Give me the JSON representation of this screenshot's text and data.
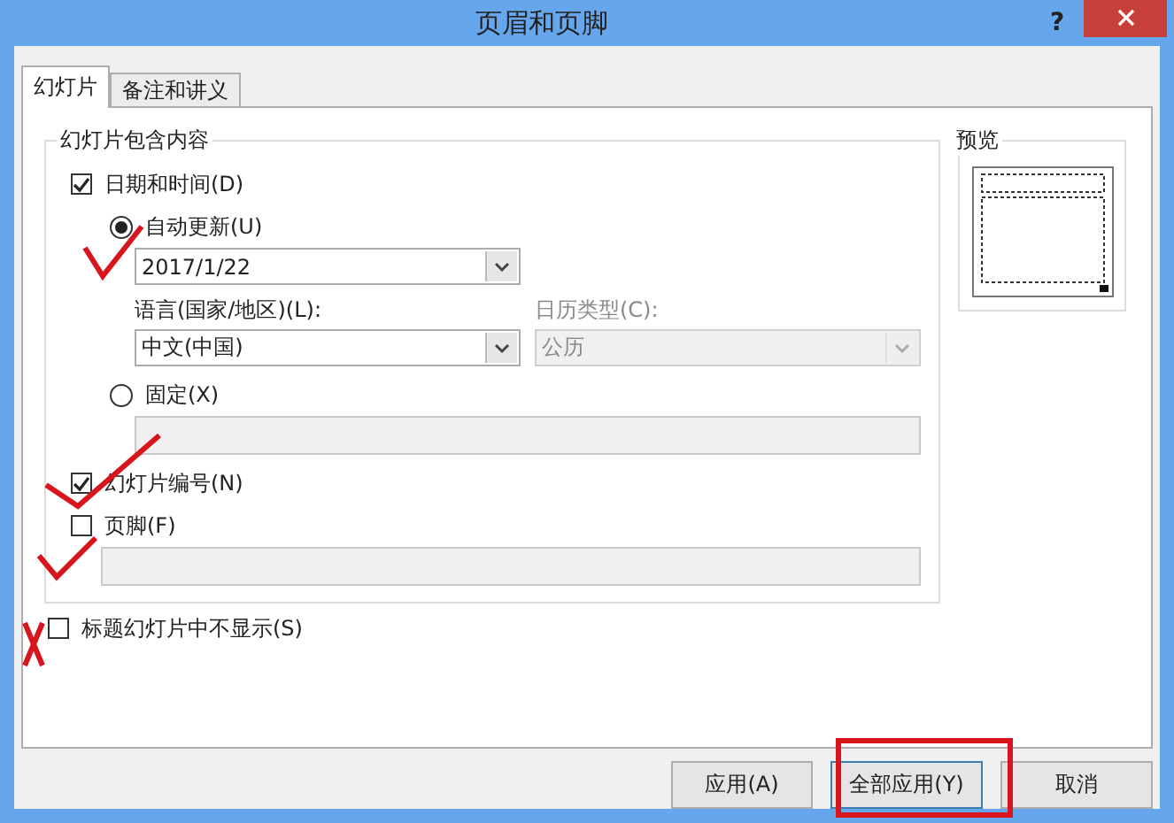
{
  "window": {
    "title": "页眉和页脚",
    "help": "?"
  },
  "tabs": [
    {
      "label": "幻灯片",
      "selected": true
    },
    {
      "label": "备注和讲义",
      "selected": false
    }
  ],
  "include_group": {
    "title": "幻灯片包含内容",
    "date_time": {
      "label": "日期和时间(D)",
      "checked": true
    },
    "auto_update": {
      "label": "自动更新(U)",
      "selected": true
    },
    "date_select": {
      "value": "2017/1/22"
    },
    "language": {
      "label": "语言(国家/地区)(L):",
      "value": "中文(中国)",
      "disabled": false
    },
    "calendar": {
      "label": "日历类型(C):",
      "value": "公历",
      "disabled": true
    },
    "fixed": {
      "label": "固定(X)",
      "selected": false
    },
    "fixed_field": {
      "disabled": true
    },
    "slide_number": {
      "label": "幻灯片编号(N)",
      "checked": true
    },
    "footer": {
      "label": "页脚(F)",
      "checked": false
    },
    "footer_field": {
      "disabled": true
    }
  },
  "preview": {
    "title": "预览"
  },
  "dont_show_on_title": {
    "label": "标题幻灯片中不显示(S)",
    "checked": false
  },
  "buttons": [
    {
      "label": "应用(A)",
      "highlighted": false
    },
    {
      "label": "全部应用(Y)",
      "highlighted": true
    },
    {
      "label": "取消",
      "highlighted": false
    }
  ]
}
